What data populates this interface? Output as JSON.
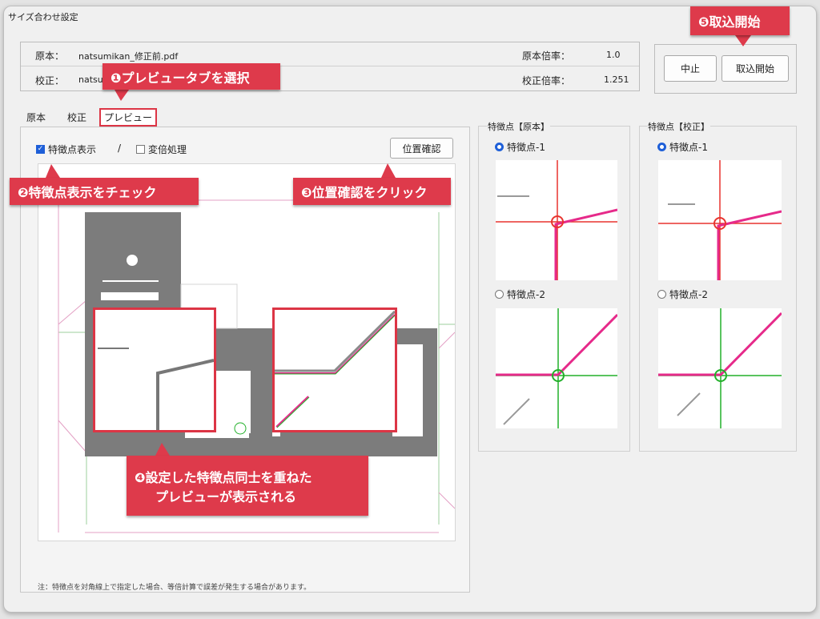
{
  "window": {
    "title": "サイズ合わせ設定"
  },
  "info": {
    "genpon_label": "原本：",
    "genpon_file": "natsumikan_修正前.pdf",
    "kousei_label": "校正：",
    "kousei_file": "natsu",
    "genpon_rate_label": "原本倍率：",
    "genpon_rate": "1.0",
    "kousei_rate_label": "校正倍率：",
    "kousei_rate": "1.251"
  },
  "buttons": {
    "cancel": "中止",
    "import": "取込開始",
    "position_check": "位置確認"
  },
  "tabs": [
    {
      "label": "原本"
    },
    {
      "label": "校正"
    },
    {
      "label": "プレビュー"
    }
  ],
  "options": {
    "feature_display": "特徴点表示",
    "slash": "/",
    "scale_process": "変倍処理",
    "feature_checked": true,
    "scale_checked": false
  },
  "groups": {
    "original": {
      "title": "特徴点【原本】",
      "p1": "特徴点-1",
      "p2": "特徴点-2"
    },
    "proof": {
      "title": "特徴点【校正】",
      "p1": "特徴点-1",
      "p2": "特徴点-2"
    }
  },
  "note": "注：特徴点を対角線上で指定した場合、等倍計算で誤差が発生する場合があります。",
  "callouts": {
    "c1": "❶プレビュータブを選択",
    "c2": "❷特徴点表示をチェック",
    "c3": "❸位置確認をクリック",
    "c4_line1": "❹設定した特徴点同士を重ねた",
    "c4_line2": "プレビューが表示される",
    "c5": "❺取込開始"
  },
  "colors": {
    "accent": "#de3a4b",
    "select_blue": "#1e5fd8",
    "feature_red": "#e8342e",
    "feature_green": "#22b02a",
    "magenta": "#e62a8a"
  }
}
